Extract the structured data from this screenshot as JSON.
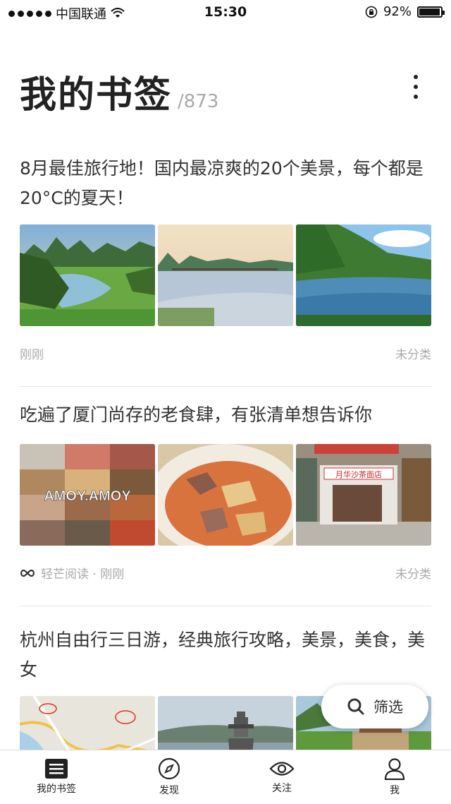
{
  "status_bar": {
    "carrier": "中国联通",
    "time": "15:30",
    "battery": "92%"
  },
  "header": {
    "title": "我的书签",
    "count": "/873"
  },
  "cards": [
    {
      "title": "8月最佳旅行地！国内最凉爽的20个美景，每个都是20°C的夏天！",
      "time": "刚刚",
      "category": "未分类"
    },
    {
      "title": "吃遍了厦门尚存的老食肆，有张清单想告诉你",
      "source": "轻芒阅读 · 刚刚",
      "category": "未分类",
      "watermark": "AMOY.AMOY",
      "shop_sign": "月华沙茶面店"
    },
    {
      "title": "杭州自由行三日游，经典旅行攻略，美景，美食，美女"
    }
  ],
  "filter": {
    "label": "筛选"
  },
  "tabs": [
    {
      "label": "我的书签"
    },
    {
      "label": "发现"
    },
    {
      "label": "关注"
    },
    {
      "label": "我"
    }
  ],
  "colors": {
    "accent": "#222222",
    "muted": "#aaaaaa",
    "divider": "#e6e6e6"
  }
}
